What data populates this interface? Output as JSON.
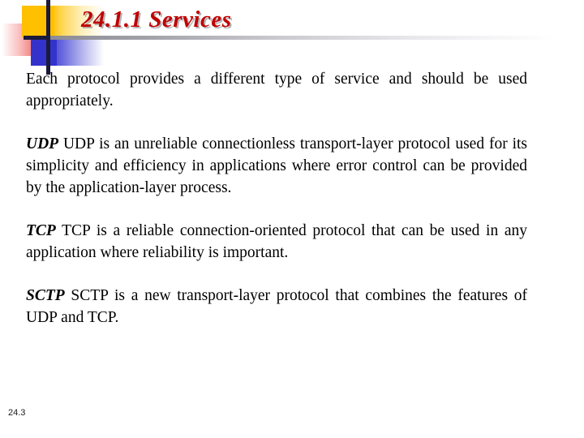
{
  "slide": {
    "title": "24.1.1  Services",
    "footer_number": "24.3",
    "colors": {
      "title_red": "#c00000",
      "art_yellow": "#ffc000",
      "art_blue": "#3333cc",
      "art_red": "#f03030",
      "art_bar_navy": "#1a1a3c",
      "rule_grey": "#8c8c95",
      "body_text": "#000000",
      "background": "#ffffff"
    },
    "paragraphs": [
      {
        "term": "",
        "text": "Each protocol provides a different type of service and should be used appropriately."
      },
      {
        "term": "UDP",
        "text": "UDP is an unreliable connectionless transport-layer protocol used for its simplicity and efficiency in applications where error control can be provided by the application-layer process."
      },
      {
        "term": "TCP",
        "text": "TCP is a reliable connection-oriented protocol that can be used in any application where reliability is important."
      },
      {
        "term": "SCTP",
        "text": "SCTP is a new transport-layer protocol that combines the features of UDP and TCP."
      }
    ]
  }
}
